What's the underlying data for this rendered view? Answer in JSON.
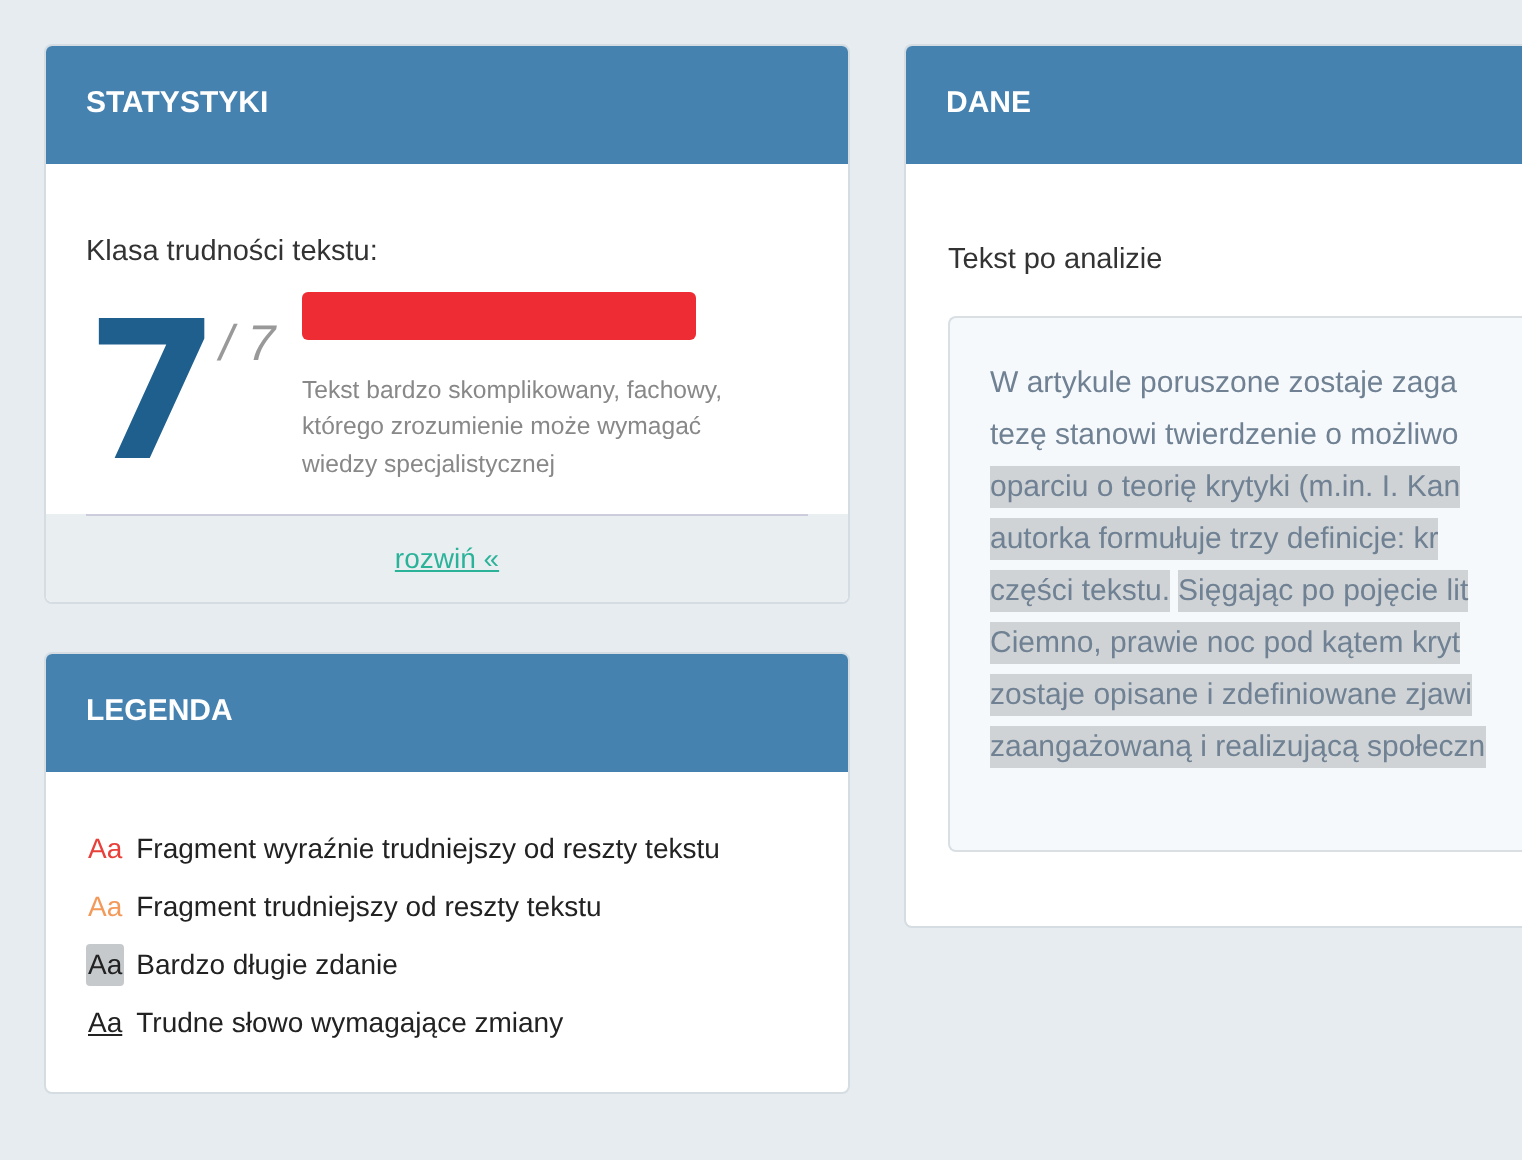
{
  "stats": {
    "title": "STATYSTYKI",
    "label": "Klasa trudności tekstu:",
    "score": "7",
    "max": "/ 7",
    "meter": {
      "level": 1,
      "color": "#ee2c34"
    },
    "description": "Tekst bardzo skomplikowany, fachowy, którego zrozumienie może wymagać wiedzy specjalistycznej",
    "expand_link": "rozwiń «"
  },
  "legend": {
    "title": "LEGENDA",
    "items": [
      {
        "kind": "color",
        "sample": "Aa",
        "color": "#e8413c",
        "label": "Fragment wyraźnie trudniejszy od reszty tekstu"
      },
      {
        "kind": "color",
        "sample": "Aa",
        "color": "#f39a5a",
        "label": "Fragment trudniejszy od reszty tekstu"
      },
      {
        "kind": "highlight",
        "sample": "Aa",
        "label": "Bardzo długie zdanie"
      },
      {
        "kind": "underline",
        "sample": "Aa",
        "label": "Trudne słowo wymagające zmiany"
      }
    ]
  },
  "data": {
    "title": "DANE",
    "label": "Tekst po analizie",
    "lines": [
      [
        {
          "text": "W artykule poruszone zostaje zaga",
          "highlight": false
        }
      ],
      [
        {
          "text": "tezę stanowi twierdzenie o możliwo",
          "highlight": false
        }
      ],
      [
        {
          "text": "oparciu o teorię krytyki (m.in. I. Kan",
          "highlight": true
        }
      ],
      [
        {
          "text": "autorka formułuje trzy definicje: kr",
          "highlight": true
        }
      ],
      [
        {
          "text": "części tekstu.",
          "highlight": true
        },
        {
          "text": "Sięgając po pojęcie lit",
          "highlight": true
        }
      ],
      [
        {
          "text": "Ciemno, prawie noc pod kątem kryt",
          "highlight": true
        }
      ],
      [
        {
          "text": "zostaje opisane i zdefiniowane zjawi",
          "highlight": true
        }
      ],
      [
        {
          "text": "zaangażowaną i realizującą społeczn",
          "highlight": true
        }
      ]
    ]
  }
}
